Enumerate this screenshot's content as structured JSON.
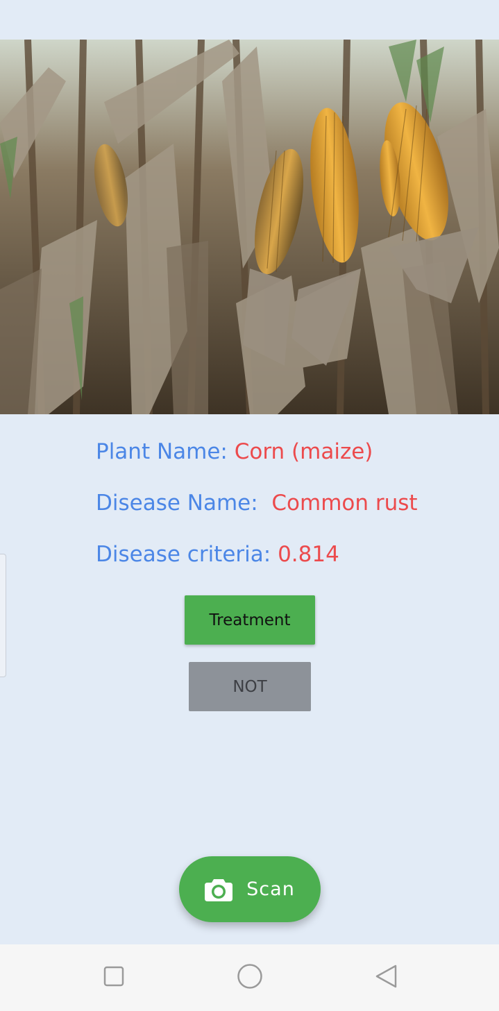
{
  "result": {
    "plant_label": "Plant Name:",
    "plant_value": "Corn (maize)",
    "disease_label": "Disease Name:",
    "disease_value": "Common rust",
    "criteria_label": "Disease criteria:",
    "criteria_value": "0.814"
  },
  "buttons": {
    "treatment_label": "Treatment",
    "not_label": "NOT"
  },
  "fab": {
    "label": "Scan",
    "icon": "camera-icon"
  },
  "nav": {
    "recents_icon": "square-icon",
    "home_icon": "circle-icon",
    "back_icon": "triangle-back-icon"
  },
  "colors": {
    "background": "#e2ebf6",
    "label_blue": "#4b86e6",
    "value_red": "#ec4a4c",
    "accent_green": "#4caf50",
    "disabled_gray": "#8d9299"
  }
}
